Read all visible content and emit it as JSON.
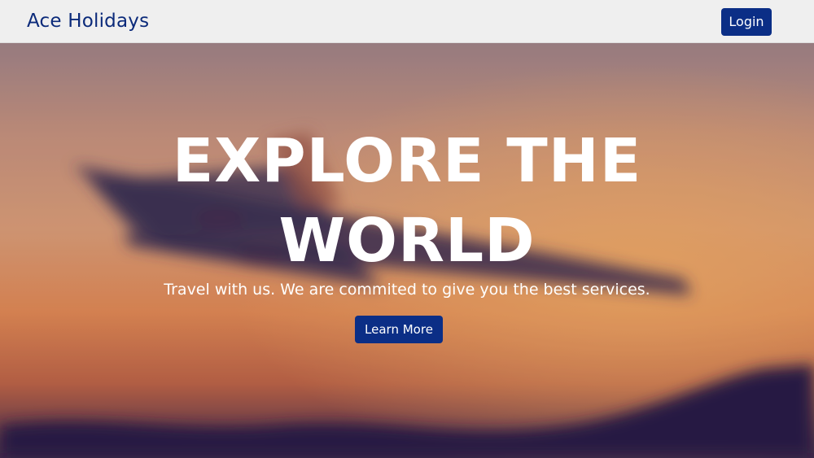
{
  "navbar": {
    "brand": "Ace Holidays",
    "login_label": "Login"
  },
  "hero": {
    "title_line1": "EXPLORE THE",
    "title_line2": "WORLD",
    "subtitle": "Travel with us. We are commited to give you the best services.",
    "cta_label": "Learn More"
  },
  "colors": {
    "brand": "#0b2a7a",
    "button": "#0b2e86",
    "navbar_bg": "#efefef"
  }
}
